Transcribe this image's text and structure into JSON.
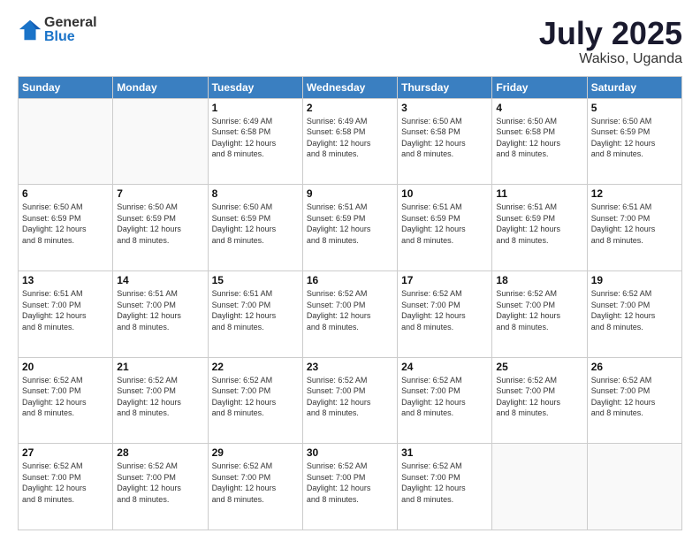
{
  "logo": {
    "general": "General",
    "blue": "Blue"
  },
  "header": {
    "month": "July 2025",
    "location": "Wakiso, Uganda"
  },
  "weekdays": [
    "Sunday",
    "Monday",
    "Tuesday",
    "Wednesday",
    "Thursday",
    "Friday",
    "Saturday"
  ],
  "weeks": [
    [
      {
        "day": "",
        "info": ""
      },
      {
        "day": "",
        "info": ""
      },
      {
        "day": "1",
        "info": "Sunrise: 6:49 AM\nSunset: 6:58 PM\nDaylight: 12 hours\nand 8 minutes."
      },
      {
        "day": "2",
        "info": "Sunrise: 6:49 AM\nSunset: 6:58 PM\nDaylight: 12 hours\nand 8 minutes."
      },
      {
        "day": "3",
        "info": "Sunrise: 6:50 AM\nSunset: 6:58 PM\nDaylight: 12 hours\nand 8 minutes."
      },
      {
        "day": "4",
        "info": "Sunrise: 6:50 AM\nSunset: 6:58 PM\nDaylight: 12 hours\nand 8 minutes."
      },
      {
        "day": "5",
        "info": "Sunrise: 6:50 AM\nSunset: 6:59 PM\nDaylight: 12 hours\nand 8 minutes."
      }
    ],
    [
      {
        "day": "6",
        "info": "Sunrise: 6:50 AM\nSunset: 6:59 PM\nDaylight: 12 hours\nand 8 minutes."
      },
      {
        "day": "7",
        "info": "Sunrise: 6:50 AM\nSunset: 6:59 PM\nDaylight: 12 hours\nand 8 minutes."
      },
      {
        "day": "8",
        "info": "Sunrise: 6:50 AM\nSunset: 6:59 PM\nDaylight: 12 hours\nand 8 minutes."
      },
      {
        "day": "9",
        "info": "Sunrise: 6:51 AM\nSunset: 6:59 PM\nDaylight: 12 hours\nand 8 minutes."
      },
      {
        "day": "10",
        "info": "Sunrise: 6:51 AM\nSunset: 6:59 PM\nDaylight: 12 hours\nand 8 minutes."
      },
      {
        "day": "11",
        "info": "Sunrise: 6:51 AM\nSunset: 6:59 PM\nDaylight: 12 hours\nand 8 minutes."
      },
      {
        "day": "12",
        "info": "Sunrise: 6:51 AM\nSunset: 7:00 PM\nDaylight: 12 hours\nand 8 minutes."
      }
    ],
    [
      {
        "day": "13",
        "info": "Sunrise: 6:51 AM\nSunset: 7:00 PM\nDaylight: 12 hours\nand 8 minutes."
      },
      {
        "day": "14",
        "info": "Sunrise: 6:51 AM\nSunset: 7:00 PM\nDaylight: 12 hours\nand 8 minutes."
      },
      {
        "day": "15",
        "info": "Sunrise: 6:51 AM\nSunset: 7:00 PM\nDaylight: 12 hours\nand 8 minutes."
      },
      {
        "day": "16",
        "info": "Sunrise: 6:52 AM\nSunset: 7:00 PM\nDaylight: 12 hours\nand 8 minutes."
      },
      {
        "day": "17",
        "info": "Sunrise: 6:52 AM\nSunset: 7:00 PM\nDaylight: 12 hours\nand 8 minutes."
      },
      {
        "day": "18",
        "info": "Sunrise: 6:52 AM\nSunset: 7:00 PM\nDaylight: 12 hours\nand 8 minutes."
      },
      {
        "day": "19",
        "info": "Sunrise: 6:52 AM\nSunset: 7:00 PM\nDaylight: 12 hours\nand 8 minutes."
      }
    ],
    [
      {
        "day": "20",
        "info": "Sunrise: 6:52 AM\nSunset: 7:00 PM\nDaylight: 12 hours\nand 8 minutes."
      },
      {
        "day": "21",
        "info": "Sunrise: 6:52 AM\nSunset: 7:00 PM\nDaylight: 12 hours\nand 8 minutes."
      },
      {
        "day": "22",
        "info": "Sunrise: 6:52 AM\nSunset: 7:00 PM\nDaylight: 12 hours\nand 8 minutes."
      },
      {
        "day": "23",
        "info": "Sunrise: 6:52 AM\nSunset: 7:00 PM\nDaylight: 12 hours\nand 8 minutes."
      },
      {
        "day": "24",
        "info": "Sunrise: 6:52 AM\nSunset: 7:00 PM\nDaylight: 12 hours\nand 8 minutes."
      },
      {
        "day": "25",
        "info": "Sunrise: 6:52 AM\nSunset: 7:00 PM\nDaylight: 12 hours\nand 8 minutes."
      },
      {
        "day": "26",
        "info": "Sunrise: 6:52 AM\nSunset: 7:00 PM\nDaylight: 12 hours\nand 8 minutes."
      }
    ],
    [
      {
        "day": "27",
        "info": "Sunrise: 6:52 AM\nSunset: 7:00 PM\nDaylight: 12 hours\nand 8 minutes."
      },
      {
        "day": "28",
        "info": "Sunrise: 6:52 AM\nSunset: 7:00 PM\nDaylight: 12 hours\nand 8 minutes."
      },
      {
        "day": "29",
        "info": "Sunrise: 6:52 AM\nSunset: 7:00 PM\nDaylight: 12 hours\nand 8 minutes."
      },
      {
        "day": "30",
        "info": "Sunrise: 6:52 AM\nSunset: 7:00 PM\nDaylight: 12 hours\nand 8 minutes."
      },
      {
        "day": "31",
        "info": "Sunrise: 6:52 AM\nSunset: 7:00 PM\nDaylight: 12 hours\nand 8 minutes."
      },
      {
        "day": "",
        "info": ""
      },
      {
        "day": "",
        "info": ""
      }
    ]
  ]
}
